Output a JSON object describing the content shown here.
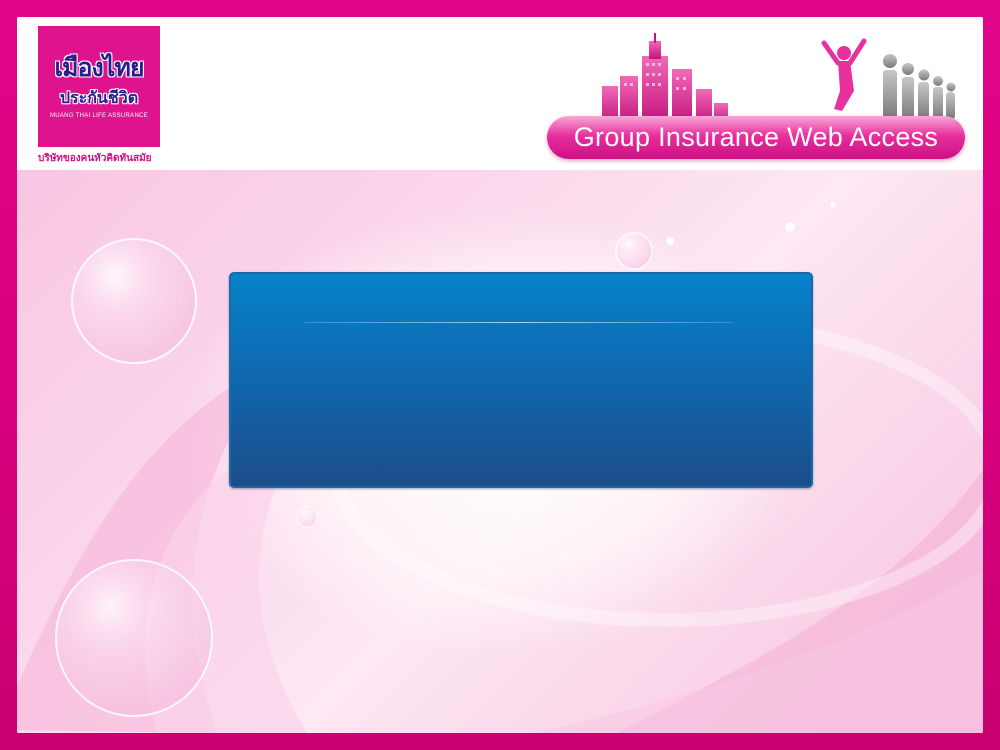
{
  "header": {
    "logo": {
      "name_th": "เมืองไทย",
      "subname_th": "ประกันชีวิต",
      "name_en": "MUANG THAI LIFE ASSURANCE",
      "tagline_th": "บริษัทของคนหัวคิดทันสมัย"
    },
    "title": "Group Insurance Web Access"
  },
  "colors": {
    "frame": "#d9007f",
    "logo_bg": "#e0138f",
    "logo_text": "#2a1d8c",
    "panel_top": "#0583cb",
    "panel_bottom": "#1b4d87",
    "title_pill": "#e8309e"
  },
  "icons": {
    "city": "city-skyline-icon",
    "people": "people-group-icon"
  }
}
